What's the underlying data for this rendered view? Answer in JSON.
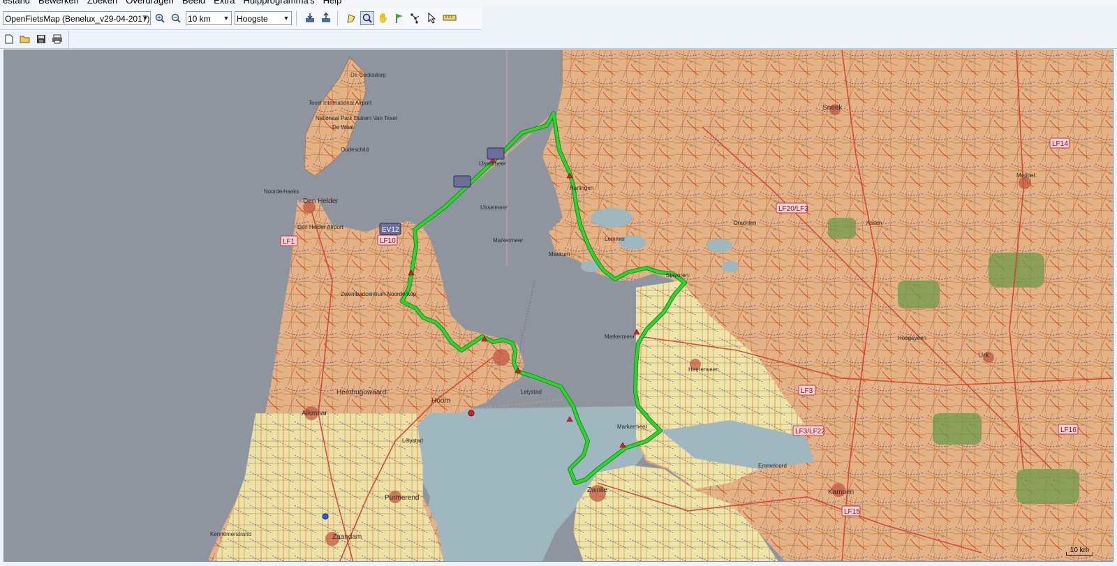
{
  "menu": [
    "estand",
    "Bewerken",
    "Zoeken",
    "Overdragen",
    "Beeld",
    "Extra",
    "Hulpprogramma's",
    "Help"
  ],
  "toolbar": {
    "map_product": "OpenFietsMap (Benelux_v29-04-2017)",
    "zoom_scale": "10 km",
    "detail_level": "Hoogste",
    "buttons": [
      "zoom-in-icon",
      "zoom-out-icon",
      "receive-from-device-icon",
      "send-to-device-icon",
      "route-icon",
      "zoom-tool-icon",
      "pan-hand-icon",
      "waypoint-flag-icon",
      "route-tool-icon",
      "select-pointer-icon",
      "measure-icon"
    ]
  },
  "file_toolbar": [
    "new-file-icon",
    "open-folder-icon",
    "save-icon",
    "print-icon"
  ],
  "map": {
    "scale_label": "10 km",
    "route_color": "#2fd52f",
    "water_color": "#8f959f",
    "lake_color": "#9fb8bf",
    "land_color": "#e9b98a",
    "place_labels": [
      "Den Helder",
      "Den Helder Airport",
      "Texel International Airport",
      "De Cocksdorp",
      "Nationaal Park Duinen Van Texel",
      "De Waal",
      "Oudeschild",
      "Noorderhaaks",
      "Zwembadcentrum Noorderkop",
      "Heerhugowaard",
      "Alkmaar",
      "Hoorn",
      "Purmerend",
      "Zaandam",
      "Kennemerstrand",
      "IJsselmeer / Ijselmar",
      "IJsselmeer",
      "Markermeer",
      "Lelystad",
      "Zwolle",
      "Kampen",
      "Emmeloord",
      "Heerenveen",
      "Sneek",
      "Drachten",
      "Assen",
      "Meppel",
      "Hoogeveen",
      "Urk",
      "Lemmer",
      "Stavoren",
      "Makkum",
      "Harlingen"
    ],
    "route_badges": [
      "LF1",
      "LF10",
      "LF20/LF3",
      "LF14",
      "LF3",
      "LF3/LF22",
      "LF15",
      "LF16"
    ],
    "ev_badges": [
      "EV12",
      "EV12"
    ]
  }
}
